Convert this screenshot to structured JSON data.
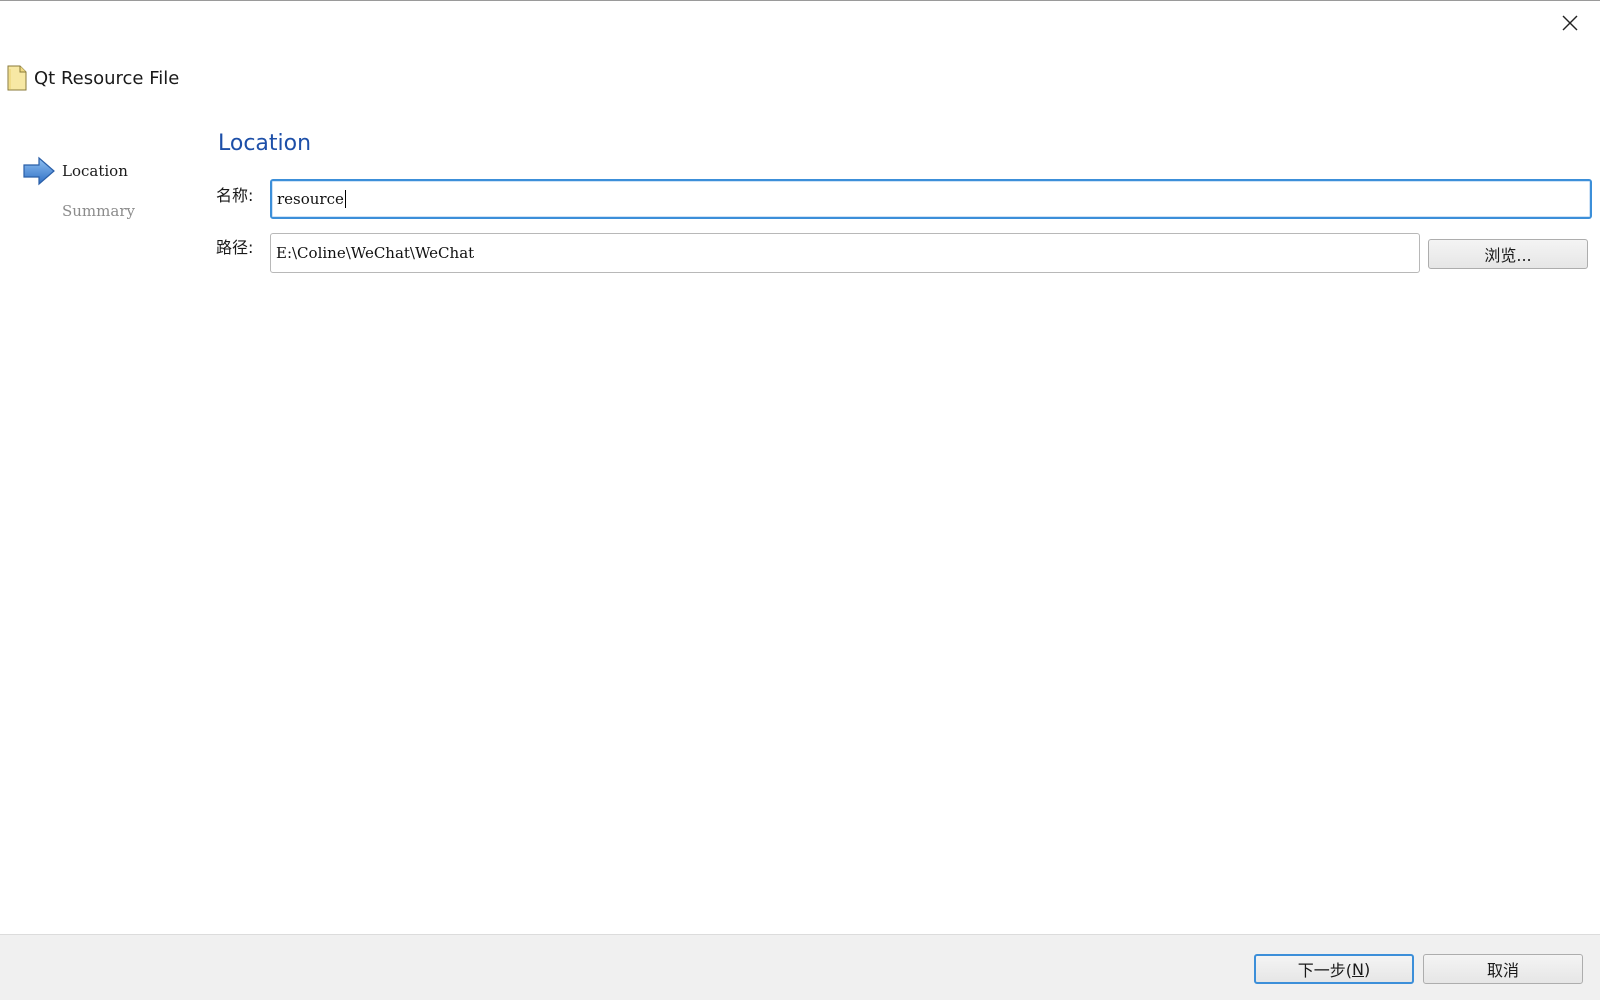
{
  "dialog": {
    "title": "Qt Resource File",
    "close_icon": "close-icon",
    "file_icon": "file-icon"
  },
  "wizard_steps": [
    {
      "label": "Location",
      "active": true,
      "icon": "arrow-right-icon"
    },
    {
      "label": "Summary",
      "active": false
    }
  ],
  "page": {
    "title": "Location",
    "name_label": "名称:",
    "name_value": "resource",
    "path_label": "路径:",
    "path_value": "E:\\Coline\\WeChat\\WeChat",
    "browse_label": "浏览..."
  },
  "footer": {
    "next_label_prefix": "下一步(",
    "next_mnemonic": "N",
    "next_label_suffix": ")",
    "cancel_label": "取消"
  },
  "colors": {
    "accent": "#3c8fd9",
    "section_title": "#1d4fa8",
    "inactive_step": "#8c8c8c",
    "footer_bg": "#f0f0f0"
  }
}
